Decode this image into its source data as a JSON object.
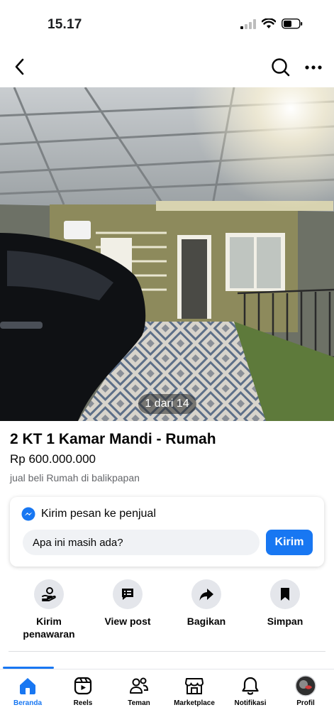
{
  "status_bar": {
    "time": "15.17"
  },
  "photo": {
    "counter": "1 dari 14"
  },
  "listing": {
    "title": "2 KT 1 Kamar Mandi - Rumah",
    "price": "Rp 600.000.000",
    "category": "jual beli Rumah di balikpapan"
  },
  "message": {
    "header": "Kirim pesan ke penjual",
    "input_value": "Apa ini masih ada?",
    "send_label": "Kirim"
  },
  "actions": [
    {
      "label": "Kirim\npenawaran",
      "icon": "offer-icon"
    },
    {
      "label": "View post",
      "icon": "post-icon"
    },
    {
      "label": "Bagikan",
      "icon": "share-icon"
    },
    {
      "label": "Simpan",
      "icon": "bookmark-icon"
    }
  ],
  "tabs": [
    {
      "label": "Beranda",
      "icon": "home-icon",
      "active": true
    },
    {
      "label": "Reels",
      "icon": "reels-icon"
    },
    {
      "label": "Teman",
      "icon": "friends-icon"
    },
    {
      "label": "Marketplace",
      "icon": "marketplace-icon"
    },
    {
      "label": "Notifikasi",
      "icon": "bell-icon"
    },
    {
      "label": "Profil",
      "icon": "avatar"
    }
  ],
  "colors": {
    "accent": "#1877f2",
    "text": "#050505",
    "muted": "#65676b"
  }
}
